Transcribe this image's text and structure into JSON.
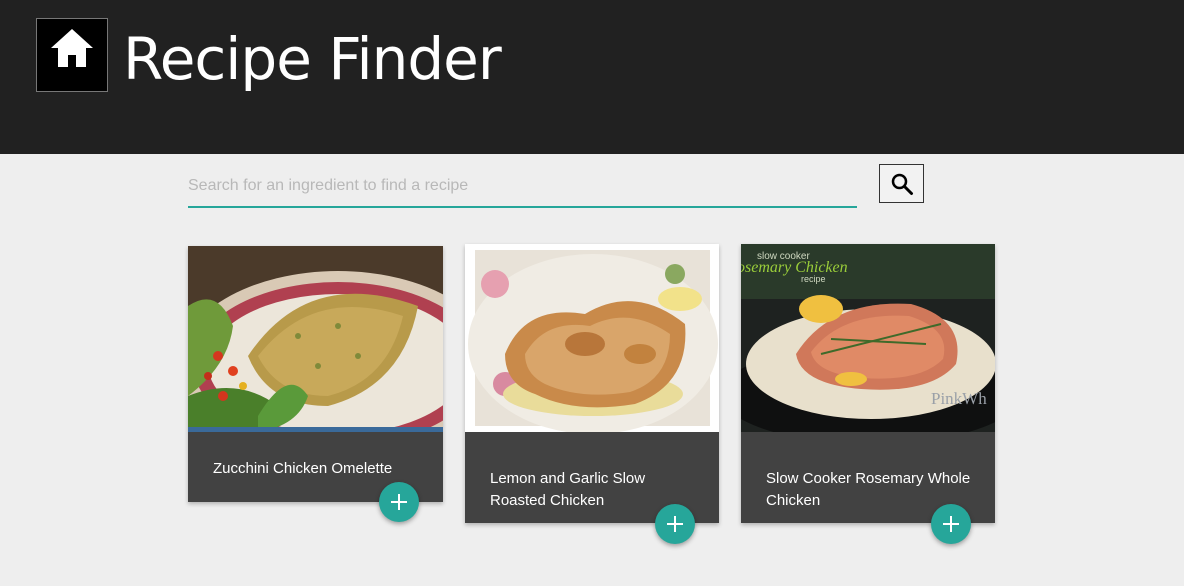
{
  "header": {
    "title": "Recipe Finder",
    "home_icon": "home-icon"
  },
  "search": {
    "placeholder": "Search for an ingredient to find a recipe",
    "value": "",
    "button_icon": "search-icon"
  },
  "colors": {
    "header_bg": "#212121",
    "page_bg": "#eeeeee",
    "accent": "#26a69a",
    "card_bg": "#424242"
  },
  "recipes": [
    {
      "title": "Zucchini Chicken Omelette",
      "add_icon": "plus-icon"
    },
    {
      "title": "Lemon and Garlic Slow Roasted Chicken",
      "add_icon": "plus-icon"
    },
    {
      "title": "Slow Cooker Rosemary Whole Chicken",
      "add_icon": "plus-icon",
      "image_text": [
        "slow cooker",
        "osemary Chicken",
        "recipe",
        "PinkWh"
      ]
    }
  ]
}
